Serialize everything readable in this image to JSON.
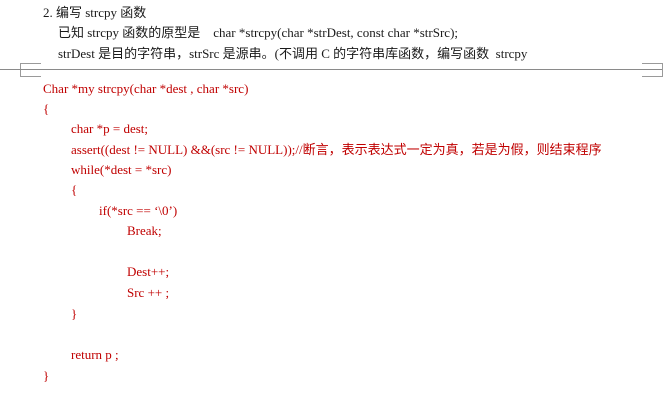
{
  "question": {
    "number_title": "2. 编写 strcpy 函数",
    "prototype_line": "已知 strcpy 函数的原型是    char *strcpy(char *strDest, const char *strSrc);",
    "description_line": "strDest 是目的字符串，strSrc 是源串。(不调用 C 的字符串库函数，编写函数  strcpy"
  },
  "code": {
    "lines": [
      "Char *my strcpy(char *dest , char *src)",
      "{",
      "char *p = dest;",
      "assert((dest != NULL) &&(src != NULL));//断言，表示表达式一定为真，若是为假，则结束程序",
      "while(*dest = *src)",
      "{",
      "if(*src == ‘\\0’)",
      "Break;",
      "Dest++;",
      "Src ++ ;",
      "}",
      "return p ;",
      "}"
    ]
  },
  "colors": {
    "text": "#1a1a1a",
    "code": "#c00000",
    "separator": "#8a8a8a"
  }
}
